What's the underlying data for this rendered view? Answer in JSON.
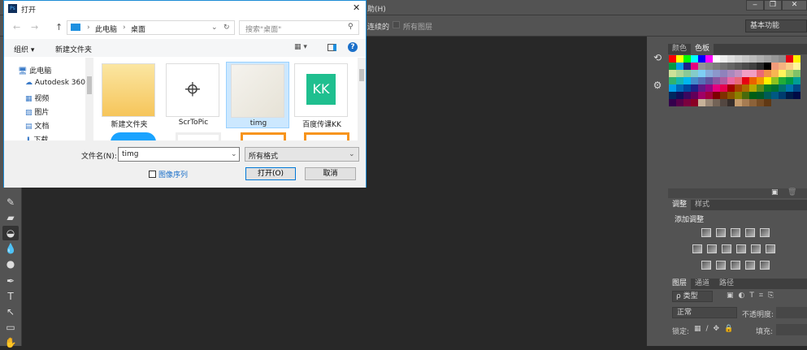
{
  "ps": {
    "menu_partial": "助(H)",
    "options": {
      "contiguous_partial": "连续的",
      "all_layers": "所有图层",
      "workspace": "基本功能"
    },
    "window_buttons": {
      "minimize": "‒",
      "restore": "❐",
      "close": "✕"
    },
    "swatch_tabs": [
      "颜色",
      "色板"
    ],
    "adjust_tabs": [
      "调整",
      "样式"
    ],
    "adjust_title": "添加调整",
    "layers_tabs": [
      "图层",
      "通道",
      "路径"
    ],
    "layers": {
      "filter": "ρ 类型",
      "blend": "正常",
      "opacity_label": "不透明度:",
      "lock_label": "锁定:",
      "fill_label": "填充:"
    },
    "swatches": [
      [
        "#ff0000",
        "#ffff00",
        "#00ff00",
        "#00ffff",
        "#0000ff",
        "#ff00ff",
        "#ffffff",
        "#eeeeee",
        "#e0e0e0",
        "#d4d4d4",
        "#c8c8c8",
        "#bcbcbc",
        "#b0b0b0",
        "#a4a4a4",
        "#989898",
        "#8c8c8c",
        "#e60012",
        "#fff100"
      ],
      [
        "#009944",
        "#00a0e9",
        "#1d2088",
        "#e4007f",
        "#959595",
        "#898989",
        "#7d7d7d",
        "#717171",
        "#656565",
        "#595959",
        "#4c4c4c",
        "#404040",
        "#2a2a2a",
        "#000000",
        "#f19c7a",
        "#f6b37f",
        "#facd89",
        "#fff799"
      ],
      [
        "#cce198",
        "#acd598",
        "#89c997",
        "#84ccc9",
        "#7ecef4",
        "#88abda",
        "#8c97cb",
        "#8f82bc",
        "#aa89bd",
        "#c490bf",
        "#f29ec2",
        "#f19ec2",
        "#eb6877",
        "#f19149",
        "#f8b551",
        "#fff45c",
        "#b3d465",
        "#80c269"
      ],
      [
        "#32b16c",
        "#13b5b1",
        "#00b7ee",
        "#448aca",
        "#556fb5",
        "#5f52a0",
        "#8957a1",
        "#ae5da1",
        "#ea68a2",
        "#eb6877",
        "#e60012",
        "#eb6100",
        "#f39800",
        "#fff100",
        "#8fc31f",
        "#22ac38",
        "#009944",
        "#009e96"
      ],
      [
        "#00a0e9",
        "#0068b7",
        "#00479d",
        "#1d2088",
        "#601986",
        "#920783",
        "#e4007f",
        "#e5004f",
        "#a40000",
        "#a84200",
        "#ac6a00",
        "#b7aa00",
        "#5f8d17",
        "#097c25",
        "#007130",
        "#00736d",
        "#0075a9",
        "#004986"
      ],
      [
        "#00275e",
        "#0f0f5a",
        "#3a0860",
        "#620059",
        "#a00066",
        "#a2003d",
        "#7d0000",
        "#7f3000",
        "#8a5400",
        "#8a8000",
        "#496a0b",
        "#005e15",
        "#005a24",
        "#005b57",
        "#005982",
        "#003b6e",
        "#001c49",
        "#000a45"
      ],
      [
        "#34004c",
        "#58004a",
        "#7b003e",
        "#8a0024",
        "#c7b299",
        "#998675",
        "#736357",
        "#534741",
        "#362e2b",
        "#c69c6d",
        "#a67c52",
        "#8c6239",
        "#754c24",
        "#603813"
      ]
    ]
  },
  "dialog": {
    "title": "打开",
    "close": "✕",
    "nav": {
      "back": "←",
      "forward": "→",
      "up": "↑"
    },
    "breadcrumb": [
      "此电脑",
      "桌面"
    ],
    "search_placeholder": "搜索\"桌面\"",
    "toolbar": {
      "organize": "组织 ▾",
      "new_folder": "新建文件夹",
      "help": "?"
    },
    "tree": [
      "此电脑",
      "Autodesk 360",
      "视频",
      "图片",
      "文档",
      "下载"
    ],
    "files": [
      "新建文件夹",
      "ScrToPic",
      "timg",
      "百度传课KK"
    ],
    "filename_label": "文件名(N):",
    "filename": "timg",
    "filetype": "所有格式",
    "image_sequence": "图像序列",
    "open": "打开(O)",
    "cancel": "取消"
  }
}
